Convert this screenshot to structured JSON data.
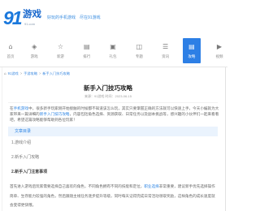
{
  "site": {
    "logo": {
      "number": "91",
      "text": "游戏",
      "sub": "91.com"
    },
    "slogan": [
      "好玩的手机游戏",
      "尽在91游戏"
    ]
  },
  "nav": {
    "active_index": 7,
    "items": [
      {
        "label": "首页",
        "icon": "home-icon"
      },
      {
        "label": "游戏",
        "icon": "gamepad-icon"
      },
      {
        "label": "新游",
        "icon": "star-icon"
      },
      {
        "label": "排行",
        "icon": "rank-icon"
      },
      {
        "label": "礼包",
        "icon": "gift-icon"
      },
      {
        "label": "专题",
        "icon": "topic-icon"
      },
      {
        "label": "资讯",
        "icon": "news-icon"
      },
      {
        "label": "攻略",
        "icon": "guide-icon"
      },
      {
        "label": "视频",
        "icon": "video-icon"
      }
    ]
  },
  "breadcrumb": {
    "home_icon": "home-icon",
    "separator": ">",
    "items": [
      "91游戏",
      "手游攻略",
      "新手入门技巧攻略"
    ]
  },
  "article": {
    "title": "新手入门技巧攻略",
    "meta": "来源：91游戏  时间：2023-06-15",
    "intro": [
      {
        "text": "在",
        "link": false
      },
      {
        "text": "手机游戏",
        "link": true
      },
      {
        "text": "中，很多新手玩家刚开始接触的时候都不知道该怎么玩，其实只要掌握正确的方法就可以快速上手，今天小编就为大家带来一篇详细的",
        "link": false
      },
      {
        "text": "新手入门技巧攻略",
        "link": true
      },
      {
        "text": "，内容包括角色选择、资源获取、日常任务以及副本挑战等，感兴趣的小伙伴们一起来看看吧，希望这篇攻略能够帮助到各位玩家！",
        "link": false
      }
    ],
    "toc": {
      "title": "文章目录",
      "items": [
        "1.游戏介绍",
        "2.新手入门攻略"
      ]
    },
    "section_heading": "2.新手入门注意事项",
    "body": [
      {
        "text": "首先进入游戏后玩家需要选择自己喜欢的角色，不同角色拥有不同的技能和定位，",
        "link": false
      },
      {
        "text": "职业选择",
        "link": true
      },
      {
        "text": "非常重要，建议新手优先选择操作简单、生存能力较强的角色，然后跟随主线任务逐步提升等级，同时每天记得完成日常活动领取奖励，这样角色的成长速度就会变得更快哦。",
        "link": false
      }
    ]
  },
  "colors": {
    "accent": "#2d7fe5",
    "link": "#2f86e4",
    "toc_background": "#eaf3fd"
  }
}
